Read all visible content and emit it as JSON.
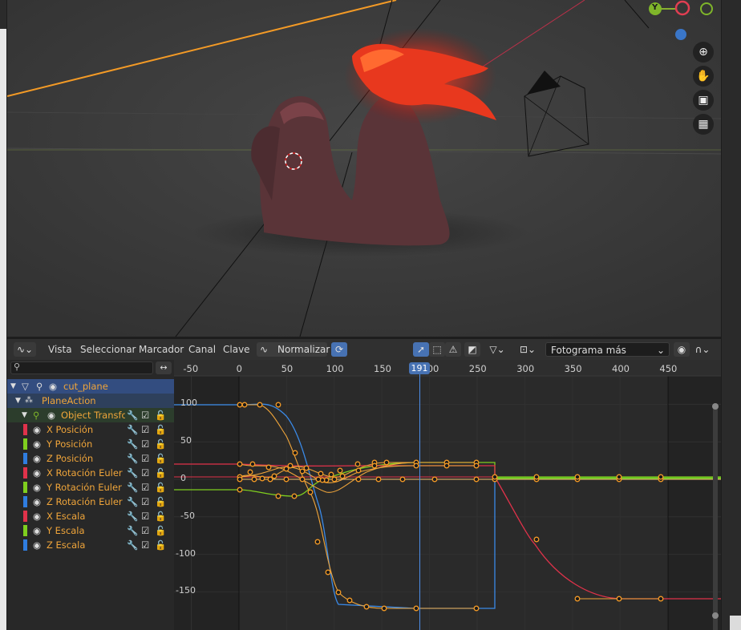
{
  "graph_editor": {
    "menu": {
      "view": "Vista",
      "select": "Seleccionar",
      "marker": "Marcador",
      "channel": "Canal",
      "key": "Clave"
    },
    "normalize_label": "Normalizar",
    "snap_mode": "Fotograma más cercano",
    "current_frame": "191",
    "x_ticks": [
      "-50",
      "0",
      "50",
      "100",
      "150",
      "200",
      "250",
      "300",
      "350",
      "400",
      "450"
    ],
    "y_ticks": [
      "100",
      "50",
      "0",
      "-50",
      "-100",
      "-150"
    ]
  },
  "channels": {
    "object": "cut_plane",
    "action": "PlaneAction",
    "group": "Object Transform",
    "items": [
      {
        "label": "X Posición",
        "color": "#e0324a"
      },
      {
        "label": "Y Posición",
        "color": "#7fce1e"
      },
      {
        "label": "Z Posición",
        "color": "#2f7de0"
      },
      {
        "label": "X Rotación Euler",
        "color": "#e0324a"
      },
      {
        "label": "Y Rotación Euler",
        "color": "#7fce1e"
      },
      {
        "label": "Z Rotación Euler",
        "color": "#2f7de0"
      },
      {
        "label": "X Escala",
        "color": "#e0324a"
      },
      {
        "label": "Y Escala",
        "color": "#7fce1e"
      },
      {
        "label": "Z Escala",
        "color": "#2f7de0"
      }
    ]
  },
  "viewport": {
    "gizmo_y": "Y"
  },
  "colors": {
    "accent": "#4772b3",
    "selected_key": "#f39a26",
    "channel_text": "#f0a53a"
  }
}
